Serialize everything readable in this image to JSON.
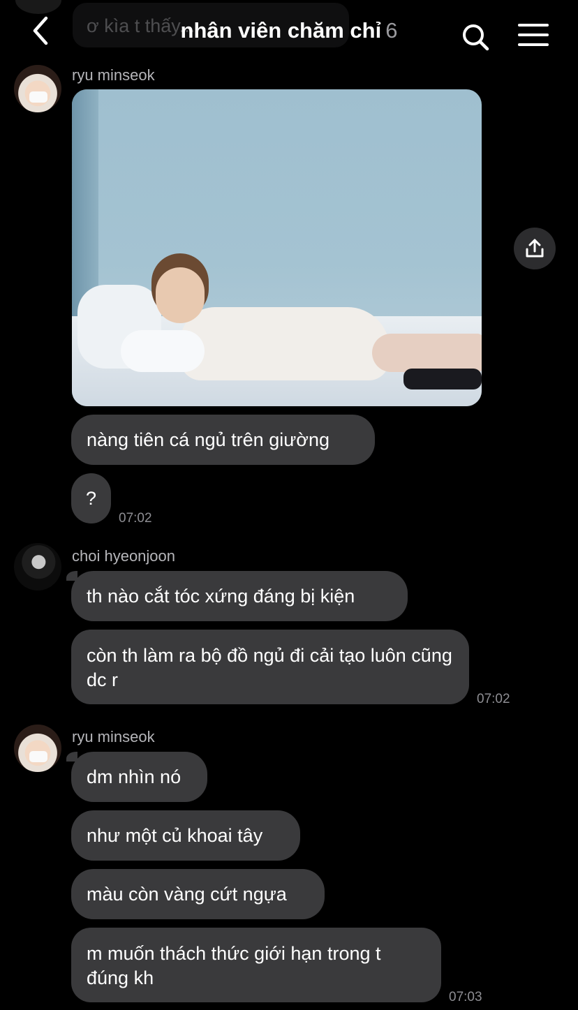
{
  "header": {
    "title": "nhân viên chăm chỉ",
    "member_count": "6",
    "previous_message_preview": "ơ kìa t thấy..."
  },
  "messages": {
    "group1": {
      "sender": "ryu minseok",
      "bubbles": [
        "nàng tiên cá ngủ trên giường",
        "?"
      ],
      "time": "07:02"
    },
    "group2": {
      "sender": "choi hyeonjoon",
      "bubbles": [
        "th nào cắt tóc xứng đáng bị kiện",
        "còn th làm ra bộ đồ ngủ đi cải tạo luôn cũng dc r"
      ],
      "time": "07:02"
    },
    "group3": {
      "sender": "ryu minseok",
      "bubbles": [
        "dm nhìn nó",
        "như một củ khoai tây",
        "màu còn vàng cứt ngựa",
        "m muốn thách thức giới hạn trong t đúng kh"
      ],
      "time": "07:03"
    }
  },
  "icons": {
    "back": "back-chevron-icon",
    "search": "search-icon",
    "menu": "hamburger-menu-icon",
    "share": "share-upload-icon"
  },
  "colors": {
    "background": "#000000",
    "bubble": "#3a3a3c",
    "sender_text": "#b6b6ba",
    "timestamp": "#8e8e93"
  }
}
